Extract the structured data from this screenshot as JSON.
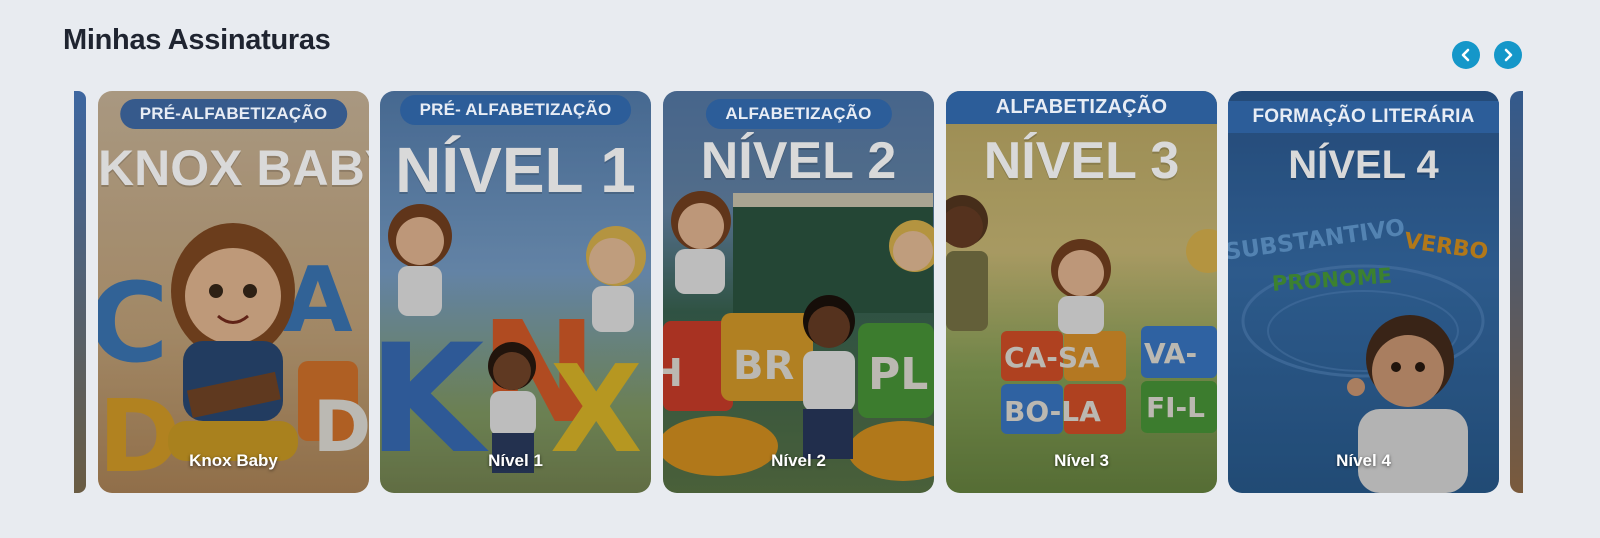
{
  "section": {
    "title": "Minhas Assinaturas"
  },
  "nav": {
    "prev_icon": "chevron-left-icon",
    "next_icon": "chevron-right-icon",
    "accent": "#1597c9"
  },
  "cards": [
    {
      "badge": "PRÉ-ALFABETIZAÇÃO",
      "headline": "KNOX BABY",
      "caption": "Knox Baby"
    },
    {
      "badge": "PRÉ- ALFABETIZAÇÃO",
      "headline": "NÍVEL 1",
      "caption": "Nível 1"
    },
    {
      "badge": "ALFABETIZAÇÃO",
      "headline": "NÍVEL 2",
      "caption": "Nível 2",
      "blocks": [
        "H",
        "BR",
        "PL"
      ]
    },
    {
      "badge": "ALFABETIZAÇÃO",
      "headline": "NÍVEL 3",
      "caption": "Nível 3",
      "blocks": [
        "CA-SA",
        "VA-",
        "BO-LA",
        "FI-L"
      ]
    },
    {
      "badge": "FORMAÇÃO LITERÁRIA",
      "headline": "NÍVEL 4",
      "caption": "Nível 4",
      "words": [
        "SUBSTANTIVO",
        "VERBO",
        "PRONOME"
      ]
    }
  ]
}
